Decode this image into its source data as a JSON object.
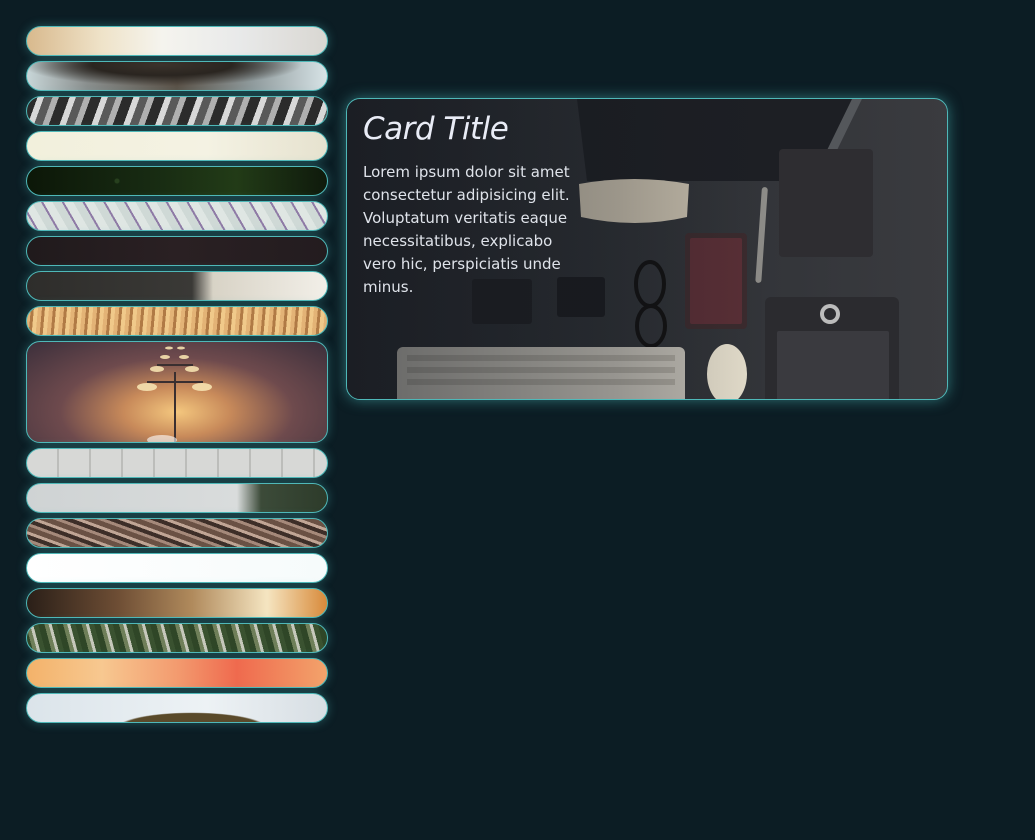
{
  "gallery": {
    "strips": [
      {
        "name": "strip-1"
      },
      {
        "name": "strip-2"
      },
      {
        "name": "strip-3"
      },
      {
        "name": "strip-4"
      },
      {
        "name": "strip-5"
      },
      {
        "name": "strip-6"
      },
      {
        "name": "strip-7"
      },
      {
        "name": "strip-8"
      },
      {
        "name": "strip-9"
      },
      {
        "name": "strip-10",
        "expanded": true
      },
      {
        "name": "strip-11"
      },
      {
        "name": "strip-12"
      },
      {
        "name": "strip-13"
      },
      {
        "name": "strip-14"
      },
      {
        "name": "strip-15"
      },
      {
        "name": "strip-16"
      },
      {
        "name": "strip-17"
      },
      {
        "name": "strip-18"
      }
    ]
  },
  "card": {
    "title": "Card Title",
    "body": "Lorem ipsum dolor sit amet consectetur adipisicing elit. Voluptatum veritatis eaque necessitatibus, explicabo vero hic, perspiciatis unde minus."
  },
  "theme": {
    "background": "#0c1d24",
    "accent": "#4fb8b8",
    "title_color": "#e9ecf6"
  }
}
